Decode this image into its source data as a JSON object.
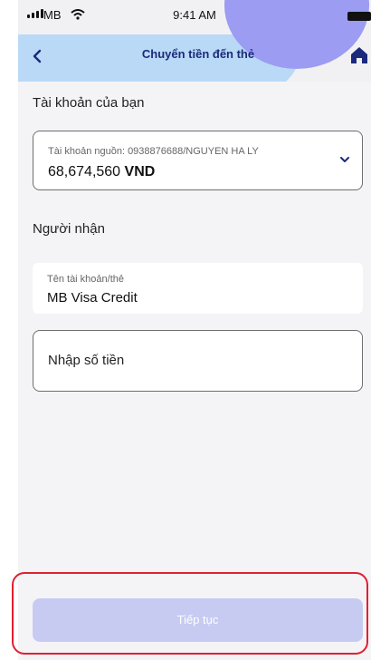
{
  "status_bar": {
    "carrier": "MB",
    "time": "9:41 AM"
  },
  "header": {
    "title": "Chuyển tiền đến thẻ",
    "back_icon": "chevron-left-icon",
    "home_icon": "home-icon"
  },
  "source_account": {
    "section_label": "Tài khoản của bạn",
    "source_line": "Tài khoản nguồn: 0938876688/NGUYEN HA LY",
    "balance_amount": "68,674,560",
    "currency": "VND",
    "dropdown_icon": "chevron-down-icon"
  },
  "recipient": {
    "section_label": "Người nhận",
    "field_label": "Tên tài khoản/thẻ",
    "field_value": "MB Visa Credit"
  },
  "amount": {
    "placeholder": "Nhập số tiền"
  },
  "footer": {
    "continue_label": "Tiếp tục"
  },
  "colors": {
    "accent": "#1b2a7a",
    "button_disabled": "#c7cbf1",
    "highlight": "#e02030"
  }
}
